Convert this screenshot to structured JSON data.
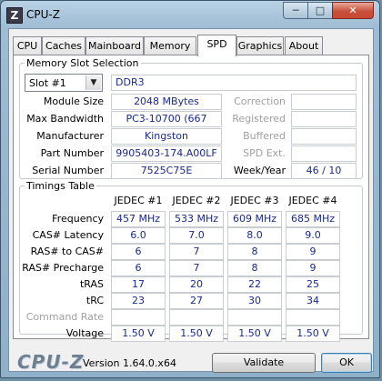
{
  "window": {
    "title": "CPU-Z",
    "app_icon_letter": "Z"
  },
  "tabs": [
    {
      "label": "CPU"
    },
    {
      "label": "Caches"
    },
    {
      "label": "Mainboard"
    },
    {
      "label": "Memory"
    },
    {
      "label": "SPD",
      "active": true
    },
    {
      "label": "Graphics"
    },
    {
      "label": "About"
    }
  ],
  "memory_slot": {
    "group_title": "Memory Slot Selection",
    "slot_selected": "Slot #1",
    "module_type": "DDR3",
    "left_fields": [
      {
        "label": "Module Size",
        "value": "2048 MBytes"
      },
      {
        "label": "Max Bandwidth",
        "value": "PC3-10700 (667 MHz)"
      },
      {
        "label": "Manufacturer",
        "value": "Kingston"
      },
      {
        "label": "Part Number",
        "value": "9905403-174.A00LF"
      },
      {
        "label": "Serial Number",
        "value": "7525C75E"
      }
    ],
    "right_fields": [
      {
        "label": "Correction",
        "value": ""
      },
      {
        "label": "Registered",
        "value": ""
      },
      {
        "label": "Buffered",
        "value": ""
      },
      {
        "label": "SPD Ext.",
        "value": ""
      },
      {
        "label": "Week/Year",
        "value": "46 / 10"
      }
    ]
  },
  "timings": {
    "group_title": "Timings Table",
    "columns": [
      "JEDEC #1",
      "JEDEC #2",
      "JEDEC #3",
      "JEDEC #4"
    ],
    "rows": [
      {
        "label": "Frequency",
        "values": [
          "457 MHz",
          "533 MHz",
          "609 MHz",
          "685 MHz"
        ]
      },
      {
        "label": "CAS# Latency",
        "values": [
          "6.0",
          "7.0",
          "8.0",
          "9.0"
        ]
      },
      {
        "label": "RAS# to CAS#",
        "values": [
          "6",
          "7",
          "8",
          "9"
        ]
      },
      {
        "label": "RAS# Precharge",
        "values": [
          "6",
          "7",
          "8",
          "9"
        ]
      },
      {
        "label": "tRAS",
        "values": [
          "17",
          "20",
          "22",
          "25"
        ]
      },
      {
        "label": "tRC",
        "values": [
          "23",
          "27",
          "30",
          "34"
        ]
      },
      {
        "label": "Command Rate",
        "values": [
          "",
          "",
          "",
          ""
        ]
      },
      {
        "label": "Voltage",
        "values": [
          "1.50 V",
          "1.50 V",
          "1.50 V",
          "1.50 V"
        ]
      }
    ]
  },
  "footer": {
    "brand": "CPU-Z",
    "version": "Version 1.64.0.x64",
    "validate_label": "Validate",
    "ok_label": "OK"
  },
  "colors": {
    "value_text": "#1a2a8a",
    "dim_label": "#a0a0a0",
    "close_button": "#c84631"
  }
}
